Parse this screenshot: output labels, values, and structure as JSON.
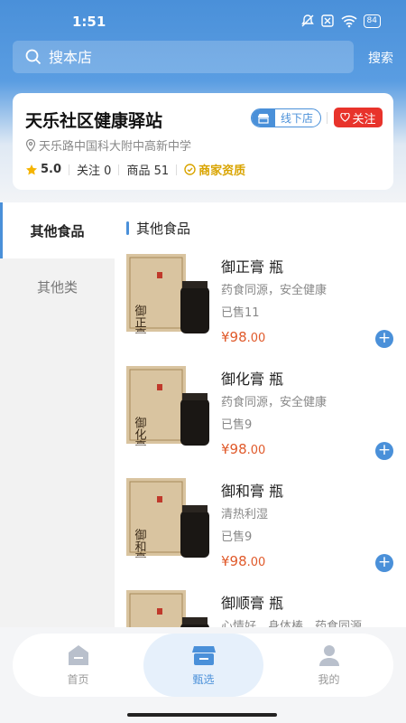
{
  "status": {
    "time": "1:51",
    "battery": "84"
  },
  "search": {
    "placeholder": "搜本店",
    "button": "搜索"
  },
  "store": {
    "name": "天乐社区健康驿站",
    "offline_badge": "线下店",
    "follow": "关注",
    "address": "天乐路中国科大附中高新中学",
    "rating": "5.0",
    "follow_count": "关注 0",
    "product_count": "商品 51",
    "qualification": "商家资质"
  },
  "sidebar": {
    "items": [
      {
        "label": "其他食品"
      },
      {
        "label": "其他类"
      }
    ]
  },
  "section_title": "其他食品",
  "products": [
    {
      "name": "御正膏 瓶",
      "desc": "药食同源，安全健康",
      "sold": "已售11",
      "price_int": "¥98",
      "price_dec": ".00",
      "label_char": "御正膏"
    },
    {
      "name": "御化膏 瓶",
      "desc": "药食同源，安全健康",
      "sold": "已售9",
      "price_int": "¥98",
      "price_dec": ".00",
      "label_char": "御化膏"
    },
    {
      "name": "御和膏 瓶",
      "desc": "清热利湿",
      "sold": "已售9",
      "price_int": "¥98",
      "price_dec": ".00",
      "label_char": "御和膏"
    },
    {
      "name": "御顺膏 瓶",
      "desc": "心情好，身体棒，药食同源，…",
      "sold": "",
      "price_int": "",
      "price_dec": "",
      "label_char": "御顺"
    }
  ],
  "tabs": [
    {
      "label": "首页"
    },
    {
      "label": "甄选"
    },
    {
      "label": "我的"
    }
  ],
  "colors": {
    "accent": "#4a90d9",
    "price": "#e05a2b",
    "follow": "#e8332b",
    "qualification": "#d9a400"
  }
}
